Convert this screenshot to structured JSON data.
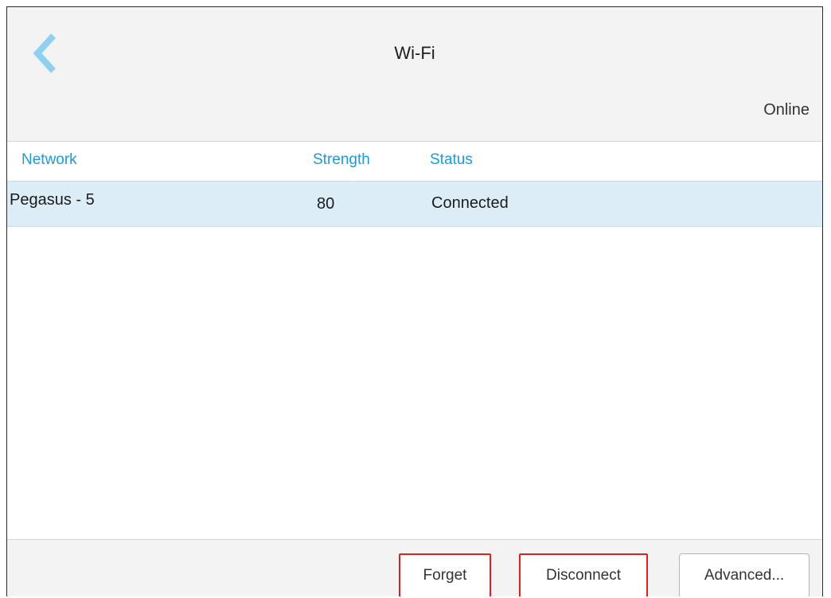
{
  "header": {
    "title": "Wi-Fi",
    "connection_status": "Online",
    "back_icon": "chevron-left-icon",
    "accent_color": "#1f9ad6"
  },
  "table": {
    "columns": [
      "Network",
      "Strength",
      "Status"
    ],
    "rows": [
      {
        "network": "Pegasus - 5",
        "strength": "80",
        "status": "Connected",
        "selected": true
      }
    ]
  },
  "footer": {
    "forget_label": "Forget",
    "disconnect_label": "Disconnect",
    "advanced_label": "Advanced...",
    "highlight_color": "#e02020"
  }
}
